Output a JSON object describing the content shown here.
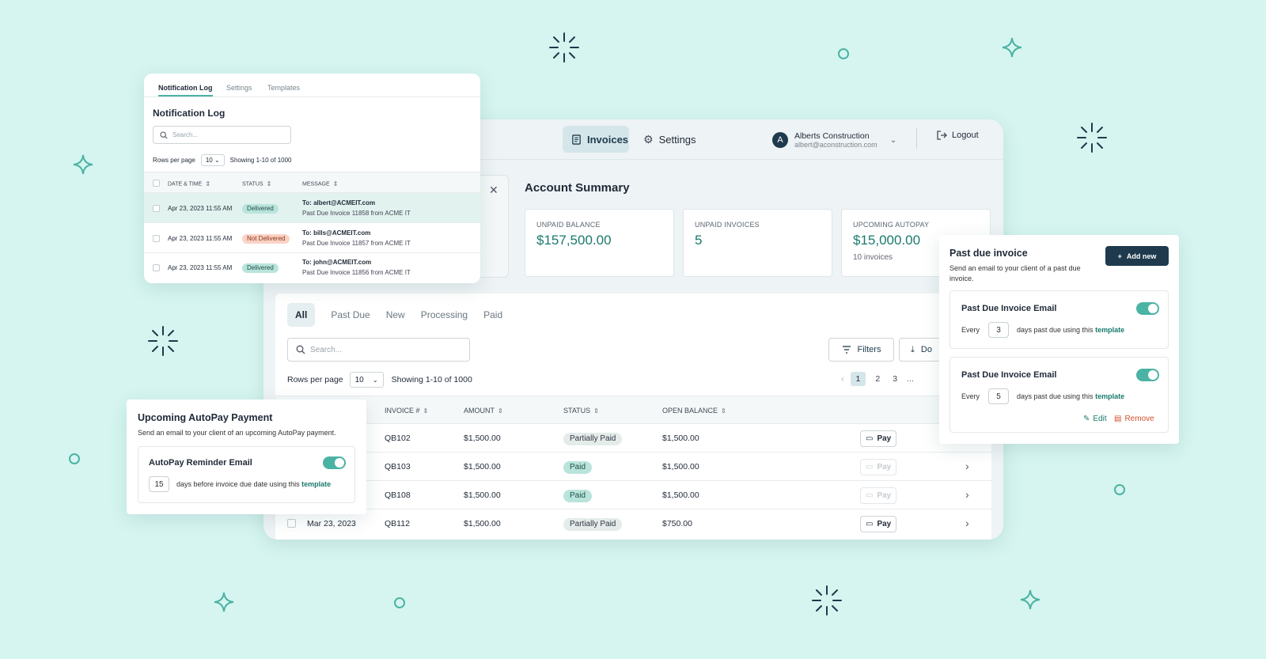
{
  "main": {
    "nav": {
      "invoices_label": "Invoices",
      "settings_label": "Settings",
      "account_name": "Alberts Construction",
      "account_email": "albert@aconstruction.com",
      "avatar_letter": "A",
      "logout_label": "Logout"
    },
    "summary": {
      "title": "Account Summary",
      "cards": [
        {
          "label": "UNPAID BALANCE",
          "value": "$157,500.00",
          "sub": ""
        },
        {
          "label": "UNPAID INVOICES",
          "value": "5",
          "sub": ""
        },
        {
          "label": "UPCOMING AUTOPAY",
          "value": "$15,000.00",
          "sub": "10 invoices"
        }
      ]
    },
    "tabs": [
      "All",
      "Past Due",
      "New",
      "Processing",
      "Paid"
    ],
    "search_placeholder": "Search...",
    "filters_label": "Filters",
    "download_label": "Do",
    "rows_per_page_label": "Rows per page",
    "rows_per_page_value": "10",
    "showing": "Showing 1-10 of 1000",
    "pages": [
      "1",
      "2",
      "3",
      "..."
    ],
    "columns": [
      "INVOICE #",
      "AMOUNT",
      "STATUS",
      "OPEN BALANCE"
    ],
    "pay_label": "Pay",
    "rows": [
      {
        "date": "",
        "invoice": "QB102",
        "amount": "$1,500.00",
        "status": "Partially Paid",
        "open": "$1,500.00"
      },
      {
        "date": "",
        "invoice": "QB103",
        "amount": "$1,500.00",
        "status": "Paid",
        "open": "$1,500.00"
      },
      {
        "date": "",
        "invoice": "QB108",
        "amount": "$1,500.00",
        "status": "Paid",
        "open": "$1,500.00"
      },
      {
        "date": "Mar 23, 2023",
        "invoice": "QB112",
        "amount": "$1,500.00",
        "status": "Partially Paid",
        "open": "$750.00"
      }
    ]
  },
  "notification_log": {
    "tabs": [
      "Notification Log",
      "Settings",
      "Templates"
    ],
    "title": "Notification Log",
    "search_placeholder": "Search...",
    "rows_per_page_label": "Rows per page",
    "rows_per_page_value": "10",
    "showing": "Showing 1-10 of 1000",
    "columns": [
      "DATE & TIME",
      "STATUS",
      "MESSAGE"
    ],
    "rows": [
      {
        "datetime": "Apr 23, 2023 11:55 AM",
        "status": "Delivered",
        "to": "To: albert@ACMEIT.com",
        "message": "Past Due Invoice 11858 from ACME IT"
      },
      {
        "datetime": "Apr 23, 2023 11:55 AM",
        "status": "Not Delivered",
        "to": "To: bills@ACMEIT.com",
        "message": "Past Due Invoice 11857 from ACME IT"
      },
      {
        "datetime": "Apr 23, 2023 11:55 AM",
        "status": "Delivered",
        "to": "To: john@ACMEIT.com",
        "message": "Past Due Invoice 11856 from ACME IT"
      }
    ]
  },
  "autopay": {
    "title": "Upcoming AutoPay Payment",
    "desc": "Send an email to your client of an upcoming AutoPay payment.",
    "reminder_title": "AutoPay Reminder Email",
    "days": "15",
    "days_text": "days before invoice due date using this",
    "template_link": "template"
  },
  "past_due": {
    "title": "Past due invoice",
    "desc": "Send an email to your client of a past due invoice.",
    "add_label": "Add new",
    "items": [
      {
        "title": "Past Due Invoice Email",
        "every": "Every",
        "days": "3",
        "text": "days past due using this",
        "link": "template"
      },
      {
        "title": "Past Due Invoice Email",
        "every": "Every",
        "days": "5",
        "text": "days past due using this",
        "link": "template"
      }
    ],
    "edit_label": "Edit",
    "remove_label": "Remove"
  },
  "colors": {
    "background": "#d6f5f0",
    "accent": "#1a7a6c",
    "dark": "#1e3a4c",
    "danger": "#d4512a"
  }
}
